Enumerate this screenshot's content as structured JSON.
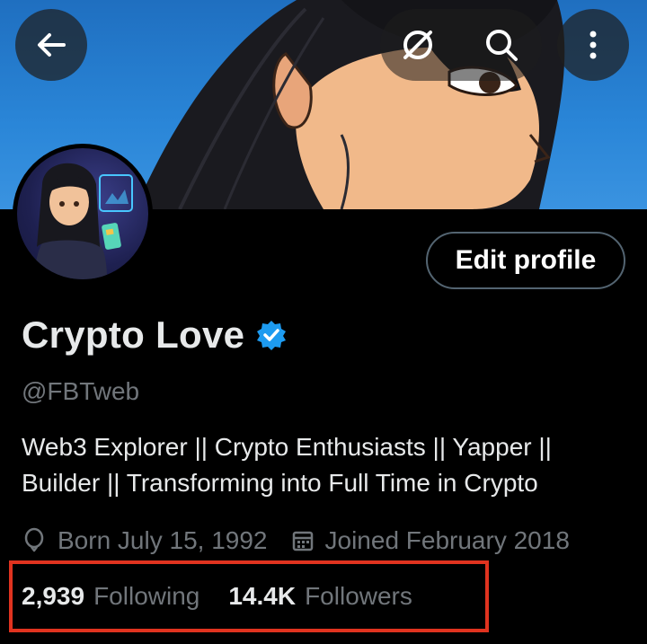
{
  "header": {
    "back_icon": "arrow-left-icon",
    "sync_off_icon": "no-sync-icon",
    "search_icon": "search-icon",
    "more_icon": "more-vertical-icon"
  },
  "profile": {
    "display_name": "Crypto Love",
    "verified": true,
    "verified_color": "#1d9bf0",
    "handle": "@FBTweb",
    "bio_line1": "Web3 Explorer || Crypto Enthusiasts || Yapper ||",
    "bio_line2": "Builder || Transforming into Full Time in Crypto",
    "birthday": "Born July 15, 1992",
    "joined": "Joined February 2018",
    "edit_button_label": "Edit profile"
  },
  "stats": {
    "following_count": "2,939",
    "following_label": "Following",
    "followers_count": "14.4K",
    "followers_label": "Followers",
    "highlight_color": "#e0331f"
  }
}
